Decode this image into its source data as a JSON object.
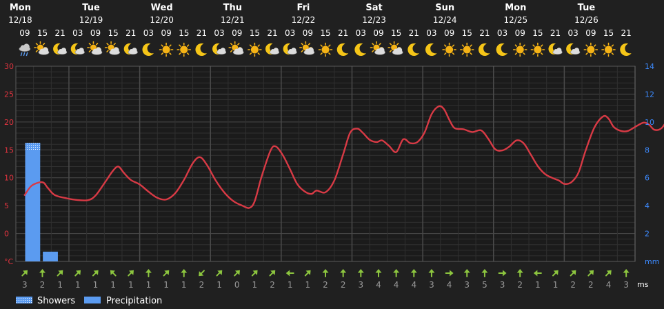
{
  "colors": {
    "background": "#202020",
    "plot_background": "#1b1b1b",
    "temperature": "#d83a45",
    "precipitation": "#5b9bf0",
    "left_axis": "#e0343f",
    "right_axis": "#3d8bff",
    "wind_arrow": "#8dc63f",
    "grid_major": "#4a4a4a",
    "grid_minor": "#303030"
  },
  "chart_data": {
    "type": "line",
    "days": [
      {
        "name": "Mon",
        "date": "12/18"
      },
      {
        "name": "Tue",
        "date": "12/19"
      },
      {
        "name": "Wed",
        "date": "12/20"
      },
      {
        "name": "Thu",
        "date": "12/21"
      },
      {
        "name": "Fri",
        "date": "12/22"
      },
      {
        "name": "Sat",
        "date": "12/23"
      },
      {
        "name": "Sun",
        "date": "12/24"
      },
      {
        "name": "Mon",
        "date": "12/25"
      },
      {
        "name": "Tue",
        "date": "12/26"
      }
    ],
    "hours": [
      "09",
      "15",
      "21",
      "03",
      "09",
      "15",
      "21",
      "03",
      "09",
      "15",
      "21",
      "03",
      "09",
      "15",
      "21",
      "03",
      "09",
      "15",
      "21",
      "03",
      "09",
      "15",
      "21",
      "03",
      "09",
      "15",
      "21",
      "03",
      "09",
      "15",
      "21",
      "03",
      "09",
      "15",
      "21"
    ],
    "weather_icons": [
      "cloud-rain-icon",
      "partly-cloudy-day-icon",
      "partly-cloudy-night-icon",
      "partly-cloudy-night-icon",
      "partly-cloudy-day-icon",
      "partly-cloudy-day-icon",
      "partly-cloudy-night-icon",
      "moon-icon",
      "sun-icon",
      "sun-icon",
      "moon-icon",
      "partly-cloudy-night-icon",
      "partly-cloudy-day-icon",
      "sun-icon",
      "partly-cloudy-night-icon",
      "partly-cloudy-night-icon",
      "partly-cloudy-day-icon",
      "sun-icon",
      "moon-icon",
      "moon-icon",
      "partly-cloudy-day-icon",
      "partly-cloudy-day-icon",
      "moon-icon",
      "moon-icon",
      "sun-icon",
      "sun-icon",
      "moon-icon",
      "moon-icon",
      "sun-icon",
      "sun-icon",
      "partly-cloudy-night-icon",
      "partly-cloudy-night-icon",
      "sun-icon",
      "sun-icon",
      "moon-icon"
    ],
    "temperature": [
      [
        0,
        6.9
      ],
      [
        0.4,
        8.6
      ],
      [
        1,
        9.2
      ],
      [
        1.3,
        8.2
      ],
      [
        1.7,
        6.9
      ],
      [
        2.4,
        6.3
      ],
      [
        3,
        6.0
      ],
      [
        3.6,
        6.0
      ],
      [
        4,
        6.8
      ],
      [
        4.5,
        9.0
      ],
      [
        5,
        11.3
      ],
      [
        5.3,
        12.0
      ],
      [
        5.6,
        10.9
      ],
      [
        6,
        9.6
      ],
      [
        6.5,
        8.8
      ],
      [
        7,
        7.5
      ],
      [
        7.5,
        6.4
      ],
      [
        8,
        6.1
      ],
      [
        8.5,
        7.2
      ],
      [
        9,
        9.6
      ],
      [
        9.5,
        12.6
      ],
      [
        9.9,
        13.7
      ],
      [
        10.3,
        12.3
      ],
      [
        10.8,
        9.5
      ],
      [
        11.3,
        7.3
      ],
      [
        11.8,
        5.8
      ],
      [
        12.3,
        5.0
      ],
      [
        12.7,
        4.6
      ],
      [
        13,
        5.8
      ],
      [
        13.4,
        10.3
      ],
      [
        13.9,
        14.9
      ],
      [
        14.2,
        15.6
      ],
      [
        14.6,
        14.0
      ],
      [
        15,
        11.5
      ],
      [
        15.4,
        8.9
      ],
      [
        15.8,
        7.6
      ],
      [
        16.2,
        7.1
      ],
      [
        16.5,
        7.7
      ],
      [
        17,
        7.4
      ],
      [
        17.5,
        9.5
      ],
      [
        18,
        14.2
      ],
      [
        18.4,
        18.1
      ],
      [
        18.8,
        18.8
      ],
      [
        19.1,
        18.1
      ],
      [
        19.5,
        16.8
      ],
      [
        19.9,
        16.4
      ],
      [
        20.2,
        16.7
      ],
      [
        20.6,
        15.7
      ],
      [
        21,
        14.6
      ],
      [
        21.4,
        16.9
      ],
      [
        21.8,
        16.2
      ],
      [
        22.2,
        16.4
      ],
      [
        22.6,
        18.1
      ],
      [
        23,
        21.4
      ],
      [
        23.4,
        22.8
      ],
      [
        23.7,
        22.3
      ],
      [
        24,
        20.4
      ],
      [
        24.3,
        18.9
      ],
      [
        24.8,
        18.7
      ],
      [
        25.3,
        18.2
      ],
      [
        25.8,
        18.5
      ],
      [
        26.2,
        17.0
      ],
      [
        26.6,
        15.1
      ],
      [
        27,
        14.9
      ],
      [
        27.4,
        15.6
      ],
      [
        27.8,
        16.7
      ],
      [
        28.2,
        16.2
      ],
      [
        28.6,
        14.2
      ],
      [
        29,
        12.1
      ],
      [
        29.4,
        10.7
      ],
      [
        29.8,
        10.0
      ],
      [
        30.2,
        9.5
      ],
      [
        30.5,
        8.9
      ],
      [
        30.9,
        9.2
      ],
      [
        31.3,
        10.9
      ],
      [
        31.7,
        14.8
      ],
      [
        32.2,
        19.0
      ],
      [
        32.7,
        21.0
      ],
      [
        33,
        20.6
      ],
      [
        33.3,
        19.1
      ],
      [
        33.7,
        18.4
      ],
      [
        34.1,
        18.4
      ],
      [
        34.6,
        19.3
      ],
      [
        35,
        19.9
      ],
      [
        35.3,
        19.5
      ],
      [
        35.6,
        18.6
      ],
      [
        36,
        18.9
      ],
      [
        36.4,
        20.8
      ],
      [
        36.8,
        22.9
      ],
      [
        37.1,
        23.7
      ],
      [
        37.5,
        23.3
      ],
      [
        37.9,
        22.3
      ],
      [
        38.3,
        21.7
      ],
      [
        38.7,
        21.9
      ],
      [
        39,
        22.2
      ]
    ],
    "precipitation": [
      {
        "x": 0.45,
        "total": 8.5,
        "showers": 0.5
      },
      {
        "x": 1.45,
        "total": 0.7,
        "showers": 0
      }
    ],
    "wind": {
      "directions": [
        45,
        0,
        45,
        45,
        45,
        -45,
        45,
        0,
        45,
        0,
        -135,
        45,
        45,
        45,
        45,
        -90,
        45,
        0,
        0,
        0,
        0,
        0,
        0,
        0,
        90,
        0,
        0,
        90,
        0,
        -90,
        45,
        45,
        45,
        45,
        0
      ],
      "speeds": [
        "3",
        "2",
        "1",
        "1",
        "1",
        "1",
        "1",
        "1",
        "1",
        "1",
        "2",
        "1",
        "0",
        "1",
        "2",
        "1",
        "1",
        "2",
        "2",
        "3",
        "4",
        "4",
        "4",
        "3",
        "4",
        "3",
        "5",
        "3",
        "2",
        "1",
        "1",
        "2",
        "2",
        "4",
        "3"
      ]
    },
    "left_axis": {
      "unit": "°C",
      "ticks": [
        "30",
        "25",
        "20",
        "15",
        "10",
        "5",
        "0"
      ],
      "ylim": [
        -5,
        30
      ]
    },
    "right_axis": {
      "unit": "mm",
      "ticks": [
        "14",
        "12",
        "10",
        "8",
        "6",
        "4",
        "2"
      ],
      "ylim": [
        0,
        14
      ]
    },
    "wind_unit": "ms",
    "legend": [
      {
        "label": "Showers",
        "icon": "showers-swatch"
      },
      {
        "label": "Precipitation",
        "icon": "precipitation-swatch"
      }
    ]
  }
}
